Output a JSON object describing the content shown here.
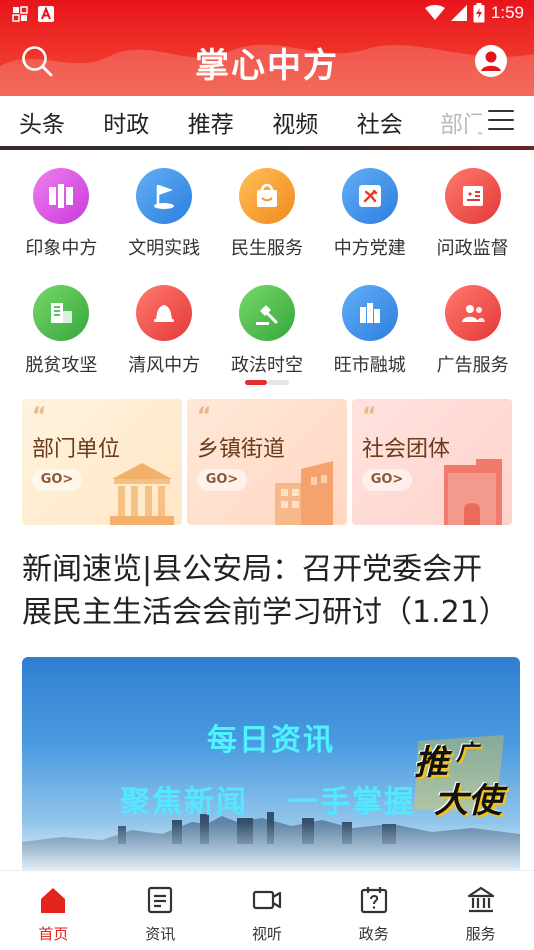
{
  "status": {
    "time": "1:59",
    "left_icons": [
      "notification-icon-1",
      "notification-icon-2"
    ],
    "right_icons": [
      "wifi-icon",
      "signal-icon",
      "battery-icon"
    ]
  },
  "header": {
    "title": "掌心中方",
    "left_icon": "search-icon",
    "right_icon": "user-icon",
    "color": "#e8141c"
  },
  "tabs": [
    "头条",
    "时政",
    "推荐",
    "视频",
    "社会",
    "部门"
  ],
  "tab_menu_icon": "menu-icon",
  "grid": [
    [
      {
        "label": "印象中方",
        "icon": "impression-icon",
        "color": "#d94ae3"
      },
      {
        "label": "文明实践",
        "icon": "flag-icon",
        "color": "#3a8ee8"
      },
      {
        "label": "民生服务",
        "icon": "bag-icon",
        "color": "#f59a2f"
      },
      {
        "label": "中方党建",
        "icon": "party-icon",
        "color": "#3a8ee8"
      },
      {
        "label": "问政监督",
        "icon": "supervision-icon",
        "color": "#ec4747"
      }
    ],
    [
      {
        "label": "脱贫攻坚",
        "icon": "building-icon",
        "color": "#46b84a"
      },
      {
        "label": "清风中方",
        "icon": "bell-icon",
        "color": "#ec4747"
      },
      {
        "label": "政法时空",
        "icon": "gavel-icon",
        "color": "#46b84a"
      },
      {
        "label": "旺市融城",
        "icon": "city-icon",
        "color": "#3a8ee8"
      },
      {
        "label": "广告服务",
        "icon": "people-icon",
        "color": "#ec4747"
      }
    ]
  ],
  "cards": [
    {
      "title": "部门单位",
      "go": "GO>"
    },
    {
      "title": "乡镇街道",
      "go": "GO>"
    },
    {
      "title": "社会团体",
      "go": "GO>"
    }
  ],
  "headline": "新闻速览|县公安局：召开党委会开展民主生活会会前学习研讨（1.21）",
  "banner": {
    "line1": "每日资讯",
    "line2a": "聚焦新闻",
    "line2b": "一手掌握",
    "badge": "推广大使"
  },
  "bottom_nav": [
    {
      "label": "首页",
      "icon": "home-icon",
      "active": true
    },
    {
      "label": "资讯",
      "icon": "news-icon",
      "active": false
    },
    {
      "label": "视听",
      "icon": "video-icon",
      "active": false
    },
    {
      "label": "政务",
      "icon": "calendar-question-icon",
      "active": false
    },
    {
      "label": "服务",
      "icon": "bank-icon",
      "active": false
    }
  ]
}
